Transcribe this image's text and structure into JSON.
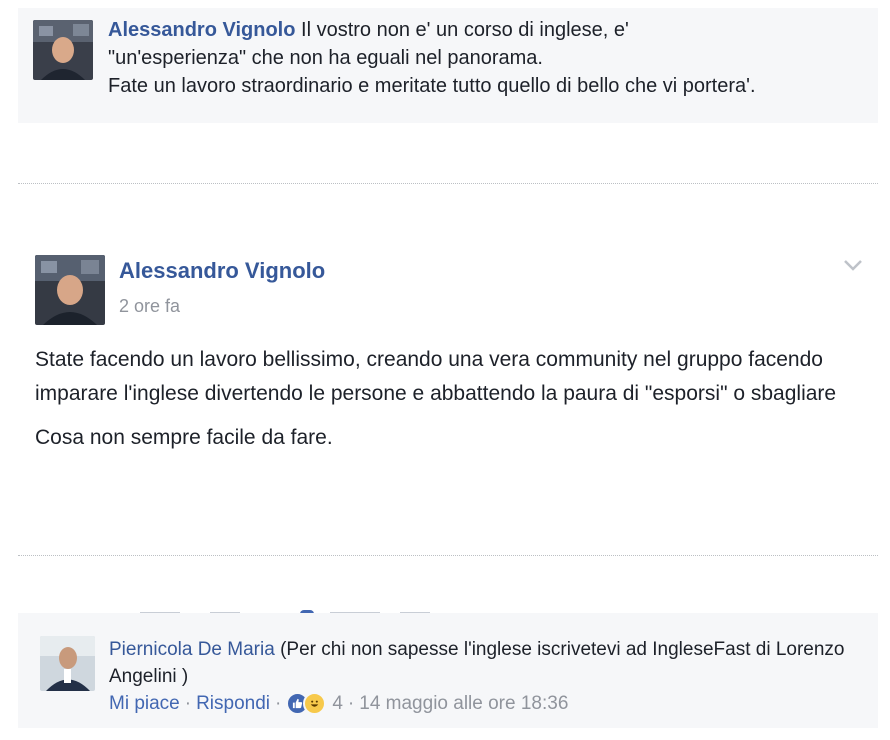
{
  "comment_top": {
    "author": "Alessandro Vignolo",
    "line1": " Il vostro non e' un corso di inglese, e'",
    "line2": "\"un'esperienza\" che non ha eguali nel panorama.",
    "line3": "Fate un lavoro straordinario e meritate tutto quello di bello che vi portera'."
  },
  "post": {
    "author": "Alessandro Vignolo",
    "time": "2 ore fa",
    "paragraph1": "State facendo un lavoro bellissimo, creando una vera community nel gruppo facendo imparare l'inglese divertendo le persone e abbattendo la paura di \"esporsi\" o sbagliare",
    "paragraph2": "Cosa non sempre facile da fare.",
    "menu_icon": "chevron-down-icon"
  },
  "comment_bottom": {
    "author": "Piernicola De Maria",
    "text": " (Per chi non sapesse l'inglese iscrivetevi ad IngleseFast di Lorenzo Angelini )",
    "like_label": "Mi piace",
    "reply_label": "Rispondi",
    "separator": "·",
    "reaction_count": "4",
    "timestamp": "14 maggio alle ore 18:36",
    "reactions": [
      "like-icon",
      "haha-icon"
    ]
  },
  "colors": {
    "name_blue": "#365899",
    "link_blue": "#4267b2",
    "meta_gray": "#90949c",
    "comment_bg": "#f6f7f9"
  }
}
